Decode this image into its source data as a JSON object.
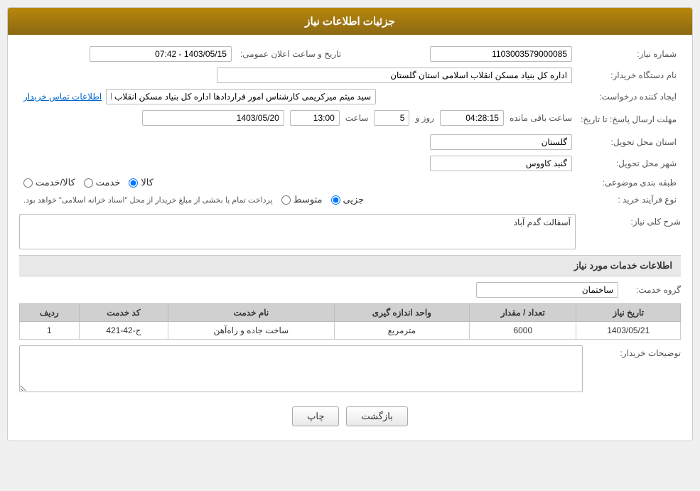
{
  "header": {
    "title": "جزئیات اطلاعات نیاز"
  },
  "fields": {
    "need_number_label": "شماره نیاز:",
    "need_number_value": "1103003579000085",
    "org_label": "نام دستگاه خریدار:",
    "org_value": "اداره کل بنیاد مسکن انقلاب اسلامی استان گلستان",
    "date_label": "تاریخ و ساعت اعلان عمومی:",
    "date_value": "1403/05/15 - 07:42",
    "creator_label": "ایجاد کننده درخواست:",
    "creator_value": "سید میثم میرکریمی کارشناس امور قراردادها اداره کل بنیاد مسکن انقلاب اسلامه",
    "contact_link": "اطلاعات تماس خریدار",
    "deadline_label": "مهلت ارسال پاسخ: تا تاریخ:",
    "deadline_date": "1403/05/20",
    "deadline_time_label": "ساعت",
    "deadline_time": "13:00",
    "deadline_days_label": "روز و",
    "deadline_days": "5",
    "deadline_remaining_label": "ساعت باقی مانده",
    "deadline_remaining": "04:28:15",
    "province_label": "استان محل تحویل:",
    "province_value": "گلستان",
    "city_label": "شهر محل تحویل:",
    "city_value": "گنبد کاووس",
    "category_label": "طبقه بندی موضوعی:",
    "category_kala": "کالا",
    "category_khedmat": "خدمت",
    "category_kala_khedmat": "کالا/خدمت",
    "purchase_type_label": "نوع فرآیند خرید :",
    "purchase_type_jozi": "جزیی",
    "purchase_type_motovaset": "متوسط",
    "purchase_type_desc": "پرداخت تمام یا بخشی از مبلغ خریدار از محل \"اسناد خزانه اسلامی\" خواهد بود.",
    "general_desc_label": "شرح کلی نیاز:",
    "general_desc_value": "آسفالت گدم آباد",
    "services_section_label": "اطلاعات خدمات مورد نیاز",
    "service_group_label": "گروه خدمت:",
    "service_group_value": "ساختمان",
    "table_headers": {
      "row_num": "ردیف",
      "service_code": "کد خدمت",
      "service_name": "نام خدمت",
      "unit": "واحد اندازه گیری",
      "qty": "تعداد / مقدار",
      "date": "تاریخ نیاز"
    },
    "table_rows": [
      {
        "row_num": "1",
        "service_code": "ج-42-421",
        "service_name": "ساخت جاده و راه‌آهن",
        "unit": "مترمربع",
        "qty": "6000",
        "date": "1403/05/21"
      }
    ],
    "buyer_notes_label": "توضیحات خریدار:",
    "buyer_notes_value": ""
  },
  "buttons": {
    "print_label": "چاپ",
    "back_label": "بازگشت"
  }
}
